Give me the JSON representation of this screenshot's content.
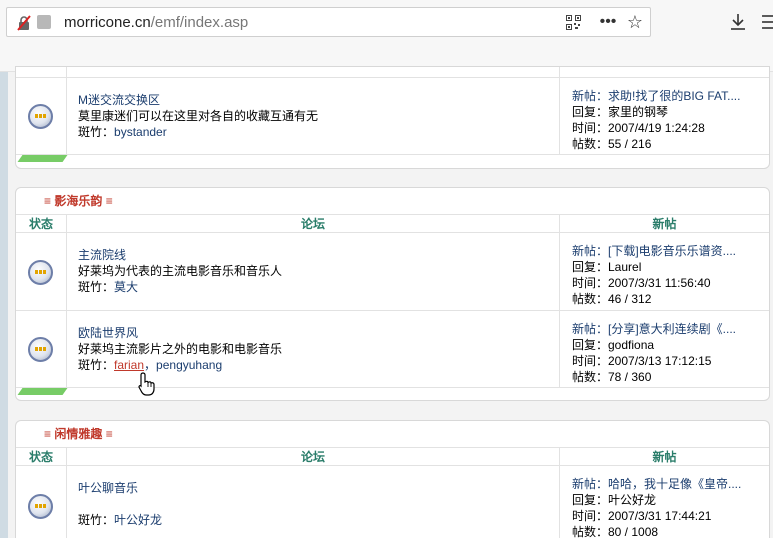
{
  "browser": {
    "url_domain": "morricone.cn",
    "url_path": "/emf/index.asp",
    "icons": [
      "lock-blocked-icon",
      "page-icon",
      "qr-code-icon",
      "more-icon",
      "star-icon",
      "download-icon",
      "menu-icon"
    ]
  },
  "block1": {
    "forums": [
      {
        "name": "M迷交流交换区",
        "desc": "莫里康迷们可以在这里对各自的收藏互通有无",
        "moderator_label": "斑竹：",
        "moderators": "bystander",
        "latest": {
          "post": "新帖：求助!找了很的BIG FAT....",
          "reply": "回复：家里的钢琴",
          "time": "时间：2007/4/19 1:24:28",
          "count": "帖数：55 / 216"
        }
      }
    ]
  },
  "block2": {
    "mark": "≡",
    "title": "影海乐韵",
    "headers": {
      "status": "状态",
      "forum": "论坛",
      "latest": "新帖"
    },
    "forums": [
      {
        "name": "主流院线",
        "desc": "好莱坞为代表的主流电影音乐和音乐人",
        "moderator_label": "斑竹：",
        "moderators": "莫大",
        "latest": {
          "post": "新帖：[下载]电影音乐乐谱资....",
          "reply": "回复：Laurel",
          "time": "时间：2007/3/31 11:56:40",
          "count": "帖数：46 / 312"
        }
      },
      {
        "name": "欧陆世界风",
        "desc": "好莱坞主流影片之外的电影和电影音乐",
        "moderator_label": "斑竹：",
        "moderator_link": "farian",
        "moderators_rest": "，pengyuhang",
        "latest": {
          "post": "新帖：[分享]意大利连续剧《....",
          "reply": "回复：godfiona",
          "time": "时间：2007/3/13 17:12:15",
          "count": "帖数：78 / 360"
        }
      }
    ]
  },
  "block3": {
    "mark": "≡",
    "title": "闲情雅趣",
    "headers": {
      "status": "状态",
      "forum": "论坛",
      "latest": "新帖"
    },
    "forums": [
      {
        "name": "叶公聊音乐",
        "desc": "",
        "moderator_label": "斑竹：",
        "moderators": "叶公好龙",
        "latest": {
          "post": "新帖：哈哈，我十足像《皇帝....",
          "reply": "回复：叶公好龙",
          "time": "时间：2007/3/31 17:44:21",
          "count": "帖数：80 / 1008"
        }
      }
    ]
  }
}
